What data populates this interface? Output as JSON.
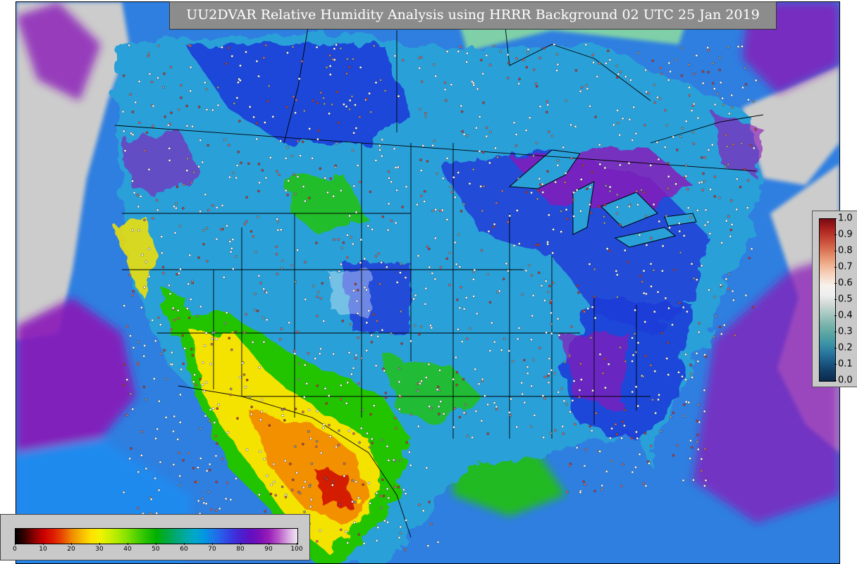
{
  "title": "UU2DVAR Relative Humidity Analysis using HRRR Background 02 UTC 25 Jan 2019",
  "bottom_colorbar": {
    "ticks": [
      "0",
      "10",
      "20",
      "30",
      "40",
      "50",
      "60",
      "70",
      "80",
      "90",
      "100"
    ],
    "colors": [
      "#000000",
      "#3a0000",
      "#8a0000",
      "#cc0000",
      "#dd1a00",
      "#e84a00",
      "#f08a00",
      "#f7b800",
      "#ffe000",
      "#f2f200",
      "#d0f000",
      "#a8ea00",
      "#7ce000",
      "#4cd000",
      "#22c000",
      "#00b000",
      "#00a838",
      "#00a870",
      "#00a8a0",
      "#00a8c8",
      "#0098e0",
      "#1a7ae8",
      "#2a5ae8",
      "#3838e0",
      "#4a20d0",
      "#6010c0",
      "#7a10b8",
      "#9a20b8",
      "#b858c8",
      "#d8a8e0",
      "#f0e8f4"
    ]
  },
  "side_colorbar": {
    "ticks": [
      "1.0",
      "0.9",
      "0.8",
      "0.7",
      "0.6",
      "0.5",
      "0.4",
      "0.3",
      "0.2",
      "0.1",
      "0.0"
    ],
    "colors": [
      "#0a2a4a",
      "#123e66",
      "#1b5a86",
      "#2a78a0",
      "#3e95a6",
      "#5aa6a2",
      "#7db6ad",
      "#a6c8c2",
      "#cfd8d6",
      "#eeeeee",
      "#f7f1ec",
      "#f7d8c4",
      "#f2b89a",
      "#e6926f",
      "#d6684c",
      "#c24232",
      "#a8201c",
      "#7a0a14"
    ]
  },
  "map": {
    "ocean_color": "#2f7fe0",
    "land_colors": {
      "humid": "#1e3cd8",
      "moist": "#2aa0d8",
      "dry_green": "#22c400",
      "dry_yellow": "#f4e200",
      "very_dry": "#f29000",
      "extreme_dry": "#d41a00",
      "saturated": "#8a18b8",
      "missing": "#cccccc"
    }
  }
}
